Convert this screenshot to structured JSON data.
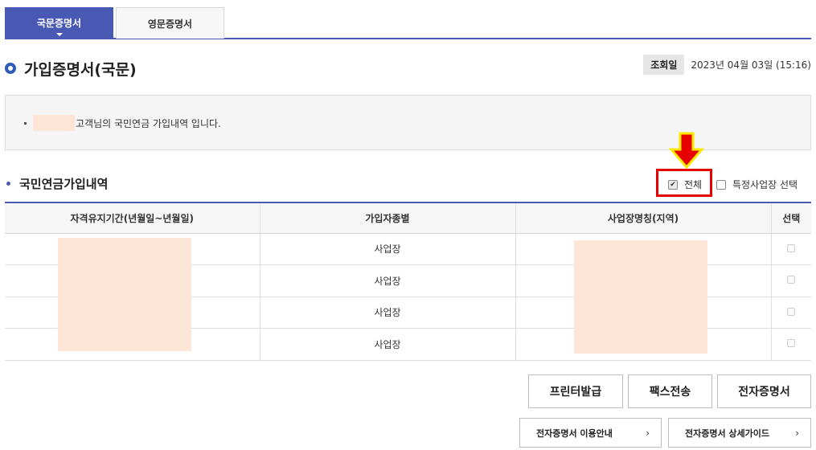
{
  "tabs": [
    {
      "label": "국문증명서",
      "active": true
    },
    {
      "label": "영문증명서",
      "active": false
    }
  ],
  "page_title": "가입증명서(국문)",
  "inquiry": {
    "label": "조회일",
    "value": "2023년 04월 03일 (15:16)"
  },
  "info": {
    "message": "고객님의 국민연금 가입내역 입니다."
  },
  "section": {
    "title": "국민연금가입내역",
    "filter_all_label": "전체",
    "filter_all_checked": true,
    "filter_site_label": "특정사업장 선택",
    "filter_site_checked": false
  },
  "table": {
    "headers": [
      "자격유지기간(년월일~년월일)",
      "가입자종별",
      "사업장명칭(지역)",
      "선택"
    ],
    "rows": [
      {
        "type": "사업장"
      },
      {
        "type": "사업장"
      },
      {
        "type": "사업장"
      },
      {
        "type": "사업장"
      }
    ]
  },
  "buttons": {
    "print": "프린터발급",
    "fax": "팩스전송",
    "ecert": "전자증명서"
  },
  "guides": {
    "usage": "전자증명서 이용안내",
    "detail": "전자증명서 상세가이드",
    "chevron": "›"
  },
  "colors": {
    "accent": "#4a59b4",
    "highlight": "#e60000",
    "arrow": "#e60000",
    "arrow_outline": "#ffe800",
    "mask": "#fde6d8"
  }
}
